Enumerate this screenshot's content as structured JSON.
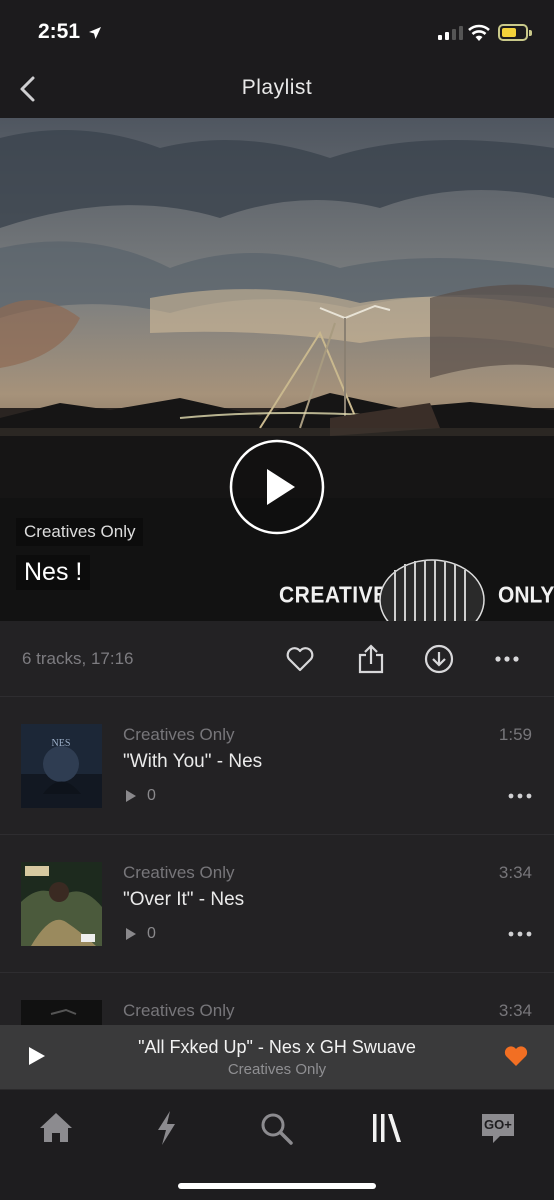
{
  "status": {
    "time": "2:51"
  },
  "nav": {
    "title": "Playlist"
  },
  "hero": {
    "creator": "Creatives Only",
    "playlist_name": "Nes !",
    "brand_left": "CREATIVES",
    "brand_right": "ONLY"
  },
  "meta": {
    "summary": "6 tracks, 17:16"
  },
  "tracks": [
    {
      "artist": "Creatives Only",
      "title": "\"With You\" - Nes",
      "duration": "1:59",
      "plays": "0"
    },
    {
      "artist": "Creatives Only",
      "title": "\"Over It\" - Nes",
      "duration": "3:34",
      "plays": "0"
    },
    {
      "artist": "Creatives Only",
      "title": "",
      "duration": "3:34",
      "plays": ""
    }
  ],
  "mini_player": {
    "song": "\"All Fxked Up\" - Nes x GH Swuave",
    "artist": "Creatives Only",
    "liked": true
  },
  "colors": {
    "accent": "#f26f23",
    "background": "#1c1b1d",
    "row": "#232224"
  },
  "tabs": [
    "home-icon",
    "stream-icon",
    "search-icon",
    "library-icon",
    "go-plus-icon"
  ],
  "tab_go_label": "GO+"
}
